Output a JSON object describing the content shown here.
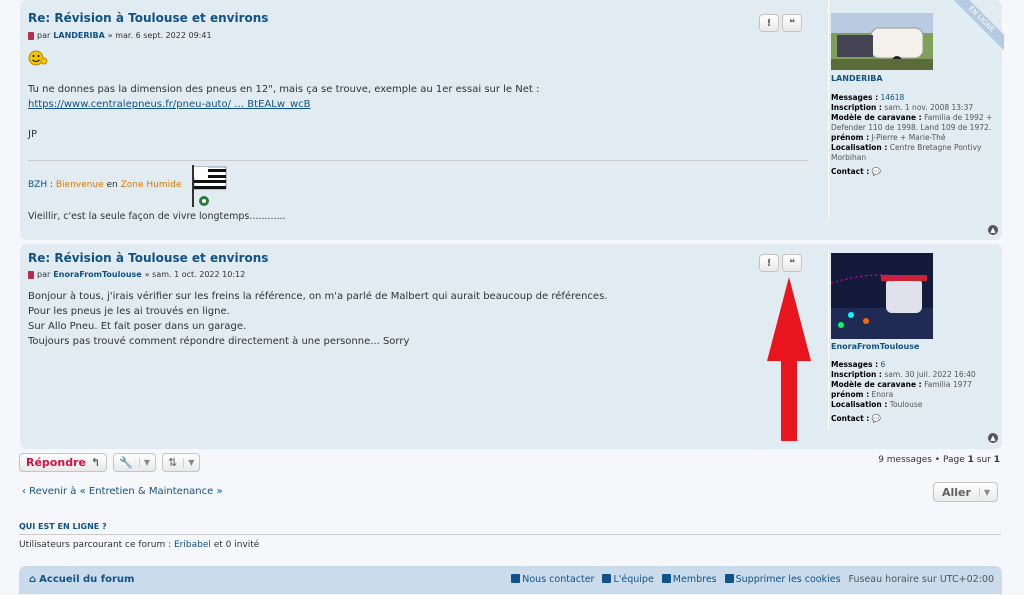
{
  "post1": {
    "title": "Re: Révision à Toulouse et environs",
    "meta_prefix": "par",
    "author": "LANDERIBA",
    "date": "» mar. 6 sept. 2022 09:41",
    "line1": "Tu ne donnes pas la dimension des pneus en 12\", mais ça se trouve, exemple au 1er essai sur le Net :",
    "link": "https://www.centralepneus.fr/pneu-auto/ … BtEALw_wcB",
    "line2": "JP",
    "sig_bzh": "BZH",
    "sig_colon": " : ",
    "sig_w1": "Bienvenue",
    "sig_w2": " en ",
    "sig_w3": "Zone",
    "sig_w4": " Humide",
    "sig_line2": "Vieillir, c'est la seule façon de vivre longtemps............",
    "btn_report": "!",
    "btn_quote": "❝",
    "online_badge": "EN LIGNE",
    "profile": {
      "name": "LANDERIBA",
      "messages_label": "Messages :",
      "messages": "14618",
      "inscription_label": "Inscription :",
      "inscription": "sam. 1 nov. 2008 13:37",
      "model_label": "Modèle de caravane :",
      "model": "Familia de 1992 + Defender 110 de 1998. Land 109 de 1972.",
      "prenom_label": "prénom :",
      "prenom": "J-Pierre + Marie-Thé",
      "loc_label": "Localisation :",
      "loc": "Centre Bretagne Pontivy Morbihan",
      "contact_label": "Contact :"
    }
  },
  "post2": {
    "title": "Re: Révision à Toulouse et environs",
    "meta_prefix": "par",
    "author": "EnoraFromToulouse",
    "date": "» sam. 1 oct. 2022 10:12",
    "lines": [
      "Bonjour à tous, j'irais vérifier sur les freins la référence, on m'a parlé de Malbert qui aurait beaucoup de références.",
      "Pour les pneus je les ai trouvés en ligne.",
      "Sur Allo Pneu. Et fait poser dans un garage.",
      "Toujours pas trouvé comment répondre directement à une personne... Sorry"
    ],
    "btn_report": "!",
    "btn_quote": "❝",
    "profile": {
      "name": "EnoraFromToulouse",
      "messages_label": "Messages :",
      "messages": "6",
      "inscription_label": "Inscription :",
      "inscription": "sam. 30 juil. 2022 16:40",
      "model_label": "Modèle de caravane :",
      "model": "Familia 1977",
      "prenom_label": "prénom :",
      "prenom": "Enora",
      "loc_label": "Localisation :",
      "loc": "Toulouse",
      "contact_label": "Contact :"
    }
  },
  "actions": {
    "reply": "Répondre",
    "pagination_count": "9 messages • Page",
    "page_current": "1",
    "page_sep": "sur",
    "page_total": "1",
    "back": "‹ Revenir à « Entretien & Maintenance »",
    "jump": "Aller"
  },
  "online": {
    "heading": "QUI EST EN LIGNE ?",
    "text_before": "Utilisateurs parcourant ce forum : ",
    "user": "Eribabel",
    "text_after": " et 0 invité"
  },
  "footer": {
    "home": "Accueil du forum",
    "contact": "Nous contacter",
    "team": "L'équipe",
    "members": "Membres",
    "cookies": "Supprimer les cookies",
    "timezone": "Fuseau horaire sur UTC+02:00"
  },
  "colors": {
    "accent": "#105289",
    "reply": "#d31141",
    "arrow": "#e8151f"
  }
}
